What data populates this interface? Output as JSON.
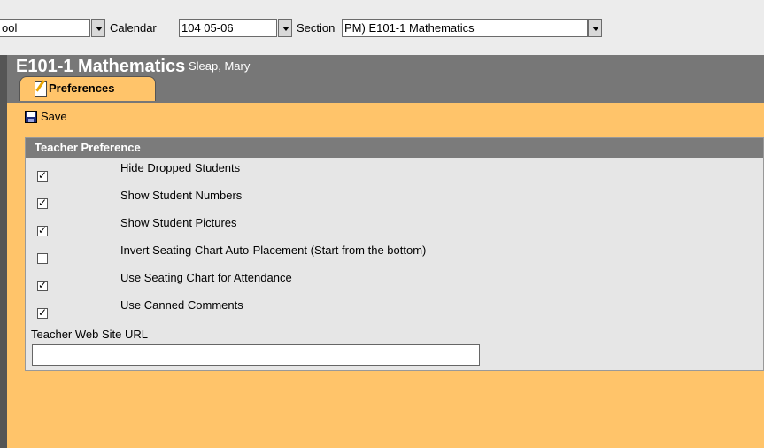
{
  "topbar": {
    "school_value": "ool",
    "calendar_label": "Calendar",
    "calendar_value": "104 05-06",
    "section_label": "Section",
    "section_value": "PM) E101-1 Mathematics"
  },
  "header": {
    "title": "E101-1 Mathematics",
    "teacher": "Sleap, Mary"
  },
  "tabs": [
    {
      "label": "Preferences",
      "active": true
    }
  ],
  "toolbar": {
    "save_label": "Save"
  },
  "panel": {
    "title": "Teacher Preference",
    "preferences": [
      {
        "label": "Hide Dropped Students",
        "checked": true
      },
      {
        "label": "Show Student Numbers",
        "checked": true
      },
      {
        "label": "Show Student Pictures",
        "checked": true
      },
      {
        "label": "Invert Seating Chart Auto-Placement (Start from the bottom)",
        "checked": false
      },
      {
        "label": "Use Seating Chart for Attendance",
        "checked": true
      },
      {
        "label": "Use Canned Comments",
        "checked": true
      }
    ],
    "url_label": "Teacher Web Site URL",
    "url_value": ""
  },
  "colors": {
    "content_bg": "#ffc46a",
    "title_band": "#777777",
    "panel_header": "#7b7b7b"
  },
  "icons": {
    "save": "floppy-disk-icon",
    "tab": "edit-note-icon",
    "dropdown": "chevron-down-icon"
  }
}
